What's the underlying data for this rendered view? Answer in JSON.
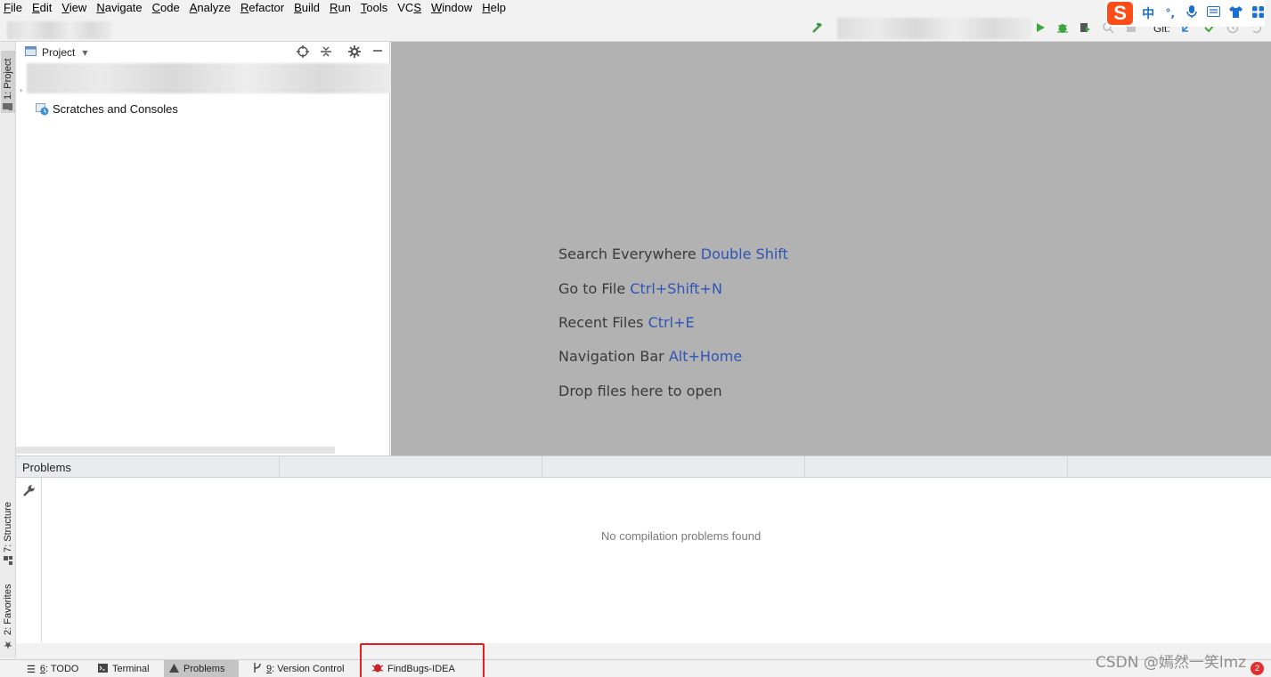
{
  "menu": [
    {
      "label": "File",
      "mnemonic": "F",
      "rest": "ile"
    },
    {
      "label": "Edit",
      "mnemonic": "E",
      "rest": "dit"
    },
    {
      "label": "View",
      "mnemonic": "V",
      "rest": "iew"
    },
    {
      "label": "Navigate",
      "mnemonic": "N",
      "rest": "avigate"
    },
    {
      "label": "Code",
      "mnemonic": "C",
      "rest": "ode"
    },
    {
      "label": "Analyze",
      "mnemonic": "A",
      "rest": "nalyze"
    },
    {
      "label": "Refactor",
      "mnemonic": "R",
      "rest": "efactor"
    },
    {
      "label": "Build",
      "mnemonic": "B",
      "rest": "uild"
    },
    {
      "label": "Run",
      "mnemonic": "R",
      "rest": "un"
    },
    {
      "label": "Tools",
      "mnemonic": "T",
      "rest": "ools"
    },
    {
      "label": "VCS",
      "mnemonic": "S",
      "rest": "VC"
    },
    {
      "label": "Window",
      "mnemonic": "W",
      "rest": "indow"
    },
    {
      "label": "Help",
      "mnemonic": "H",
      "rest": "elp"
    }
  ],
  "toolbar": {
    "git_label": "Git:",
    "icons": [
      "hammer-icon",
      "run-icon",
      "debug-icon",
      "coverage-icon",
      "profile-icon",
      "stop-icon",
      "git-update-icon",
      "git-commit-icon",
      "git-history-icon",
      "git-rollback-icon"
    ]
  },
  "ime": {
    "logo": "S",
    "mode": "中",
    "punct": "°,",
    "icons": [
      "microphone-icon",
      "keyboard-icon",
      "shirt-icon",
      "grid-icon"
    ]
  },
  "left_strip": {
    "project_tab": "1: Project",
    "structure_tab": "7: Structure",
    "favorites_tab": "2: Favorites"
  },
  "project_panel": {
    "title": "Project",
    "tree_item": "Scratches and Consoles"
  },
  "editor_hints": [
    {
      "text": "Search Everywhere",
      "key": "Double Shift"
    },
    {
      "text": "Go to File",
      "key": "Ctrl+Shift+N"
    },
    {
      "text": "Recent Files",
      "key": "Ctrl+E"
    },
    {
      "text": "Navigation Bar",
      "key": "Alt+Home"
    },
    {
      "text": "Drop files here to open",
      "key": ""
    }
  ],
  "problems": {
    "title": "Problems",
    "empty_message": "No compilation problems found"
  },
  "bottom_tabs": [
    {
      "num": "6",
      "label": ": TODO"
    },
    {
      "num": "",
      "label": "Terminal"
    },
    {
      "num": "",
      "label": "Problems"
    },
    {
      "num": "9",
      "label": ": Version Control"
    },
    {
      "num": "",
      "label": "FindBugs-IDEA"
    }
  ],
  "watermark": "CSDN @嫣然一笑lmz",
  "notifications_count": "2",
  "colors": {
    "accent_key": "#2f55b5",
    "editor_bg": "#b2b2b2",
    "highlight": "#e41f1f",
    "ime_logo": "#ff4d1a"
  }
}
